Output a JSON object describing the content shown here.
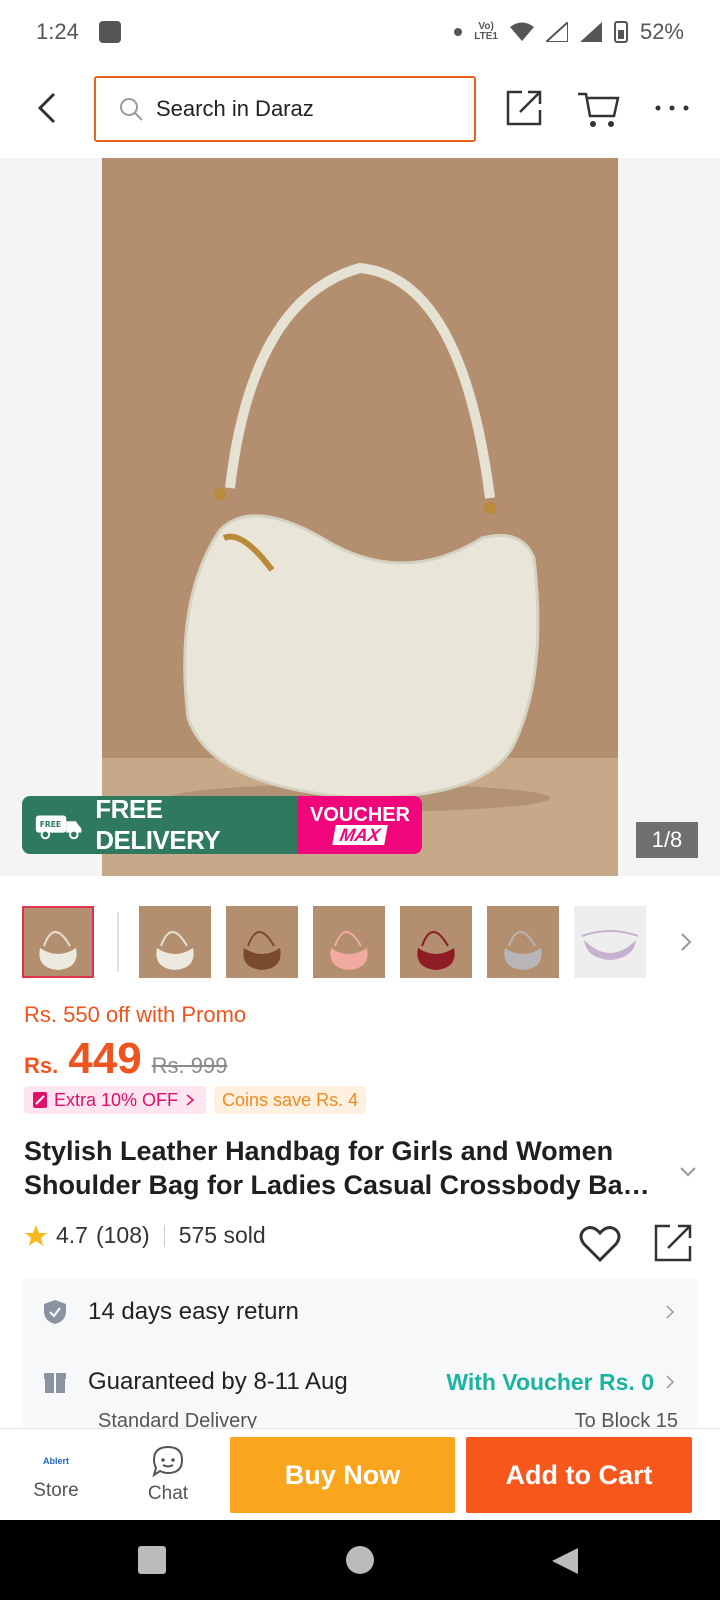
{
  "status_bar": {
    "time": "1:24",
    "battery": "52%",
    "network": "VoLTE LTE1"
  },
  "nav": {
    "search_placeholder": "Search in Daraz"
  },
  "gallery": {
    "free_delivery": "FREE DELIVERY",
    "free_tag": "FREE",
    "voucher_line1": "VOUCHER",
    "voucher_line2": "MAX",
    "counter": "1/8",
    "thumb_colors": [
      "#ece9df",
      "#ece9df",
      "#7a4a2c",
      "#f2a99f",
      "#8e1c25",
      "#b7b5b8",
      "#c6b1cf"
    ]
  },
  "price": {
    "promo": "Rs. 550 off with Promo",
    "currency": "Rs.",
    "value": "449",
    "original": "Rs. 999",
    "extra_off": "Extra 10% OFF",
    "coins": "Coins save Rs. 4"
  },
  "product": {
    "title_line1": "Stylish Leather Handbag for Girls and Women",
    "title_line2": "Shoulder Bag for Ladies Casual Crossbody Bag for Women"
  },
  "rating": {
    "score": "4.7",
    "count": "(108)",
    "sold": "575 sold"
  },
  "service": {
    "return": "14 days easy return",
    "delivery": "Guaranteed by 8-11 Aug",
    "voucher": "With Voucher Rs. 0",
    "delivery_type": "Standard Delivery",
    "destination": "To Block 15"
  },
  "actions": {
    "store": "Store",
    "store_logo": "Ablert",
    "chat": "Chat",
    "buy_now": "Buy Now",
    "add_to_cart": "Add to Cart"
  },
  "colors": {
    "accent": "#f6571b",
    "buy_now": "#f9a51d",
    "promo_green": "#2f7a5f",
    "voucher_pink": "#f0057a",
    "teal": "#1bb49e"
  }
}
